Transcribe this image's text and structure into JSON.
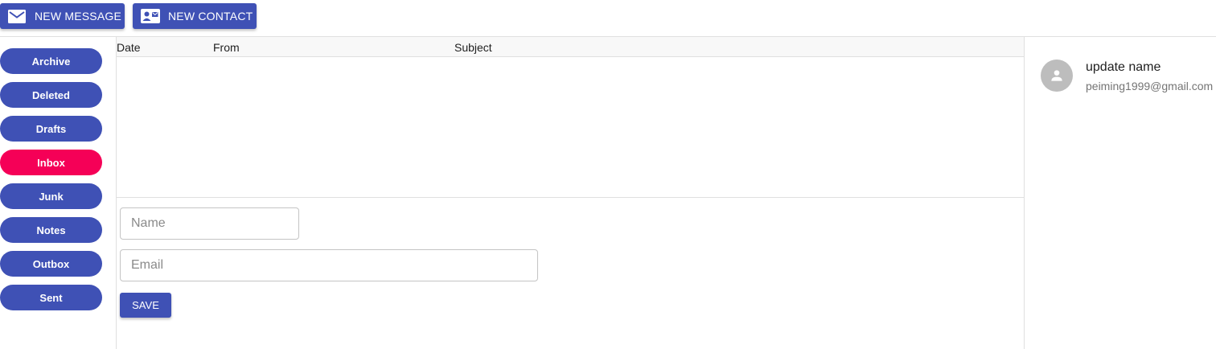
{
  "toolbar": {
    "new_message_label": "NEW MESSAGE",
    "new_contact_label": "NEW CONTACT"
  },
  "folders": [
    {
      "label": "Archive",
      "active": false
    },
    {
      "label": "Deleted",
      "active": false
    },
    {
      "label": "Drafts",
      "active": false
    },
    {
      "label": "Inbox",
      "active": true
    },
    {
      "label": "Junk",
      "active": false
    },
    {
      "label": "Notes",
      "active": false
    },
    {
      "label": "Outbox",
      "active": false
    },
    {
      "label": "Sent",
      "active": false
    }
  ],
  "message_list": {
    "columns": [
      "Date",
      "From",
      "Subject"
    ],
    "rows": []
  },
  "contact_form": {
    "name_placeholder": "Name",
    "name_value": "",
    "email_placeholder": "Email",
    "email_value": "",
    "save_label": "SAVE"
  },
  "contacts": [
    {
      "name": "update name",
      "email": "peiming1999@gmail.com",
      "icon": "person-icon"
    }
  ],
  "colors": {
    "primary": "#3f51b5",
    "accent": "#f50057",
    "avatar": "#bdbdbd"
  }
}
